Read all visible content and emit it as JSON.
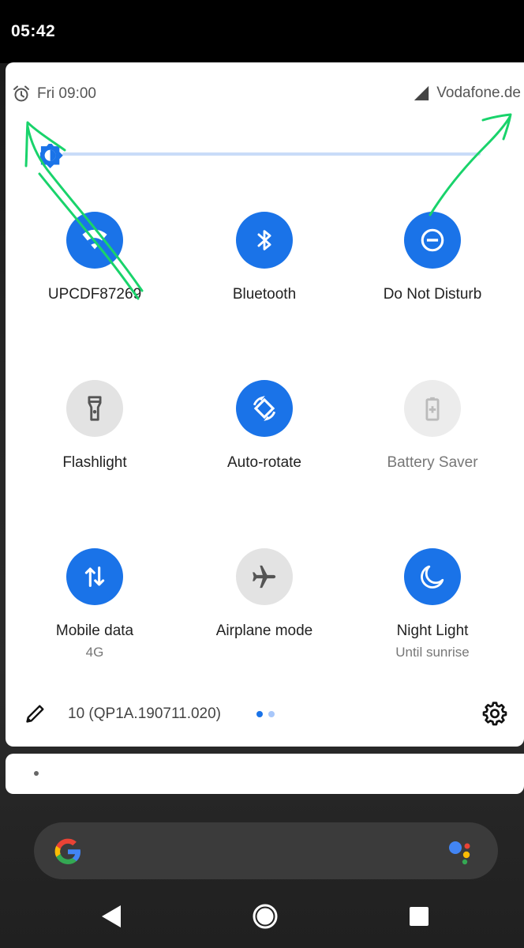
{
  "status_bar": {
    "time": "05:42"
  },
  "header": {
    "alarm": "Fri 09:00",
    "carrier": "Vodafone.de"
  },
  "brightness": {
    "level": 0.0
  },
  "tiles": [
    {
      "label": "UPCDF87269",
      "sub": "",
      "active": true,
      "icon": "wifi-icon"
    },
    {
      "label": "Bluetooth",
      "sub": "",
      "active": true,
      "icon": "bluetooth-icon"
    },
    {
      "label": "Do Not Disturb",
      "sub": "",
      "active": true,
      "icon": "do-not-disturb-icon"
    },
    {
      "label": "Flashlight",
      "sub": "",
      "active": false,
      "icon": "flashlight-icon"
    },
    {
      "label": "Auto-rotate",
      "sub": "",
      "active": true,
      "icon": "auto-rotate-icon"
    },
    {
      "label": "Battery Saver",
      "sub": "",
      "active": false,
      "unavailable": true,
      "icon": "battery-saver-icon"
    },
    {
      "label": "Mobile data",
      "sub": "4G",
      "active": true,
      "icon": "mobile-data-icon"
    },
    {
      "label": "Airplane mode",
      "sub": "",
      "active": false,
      "icon": "airplane-icon"
    },
    {
      "label": "Night Light",
      "sub": "Until sunrise",
      "active": true,
      "icon": "night-light-icon"
    }
  ],
  "footer": {
    "build": "10 (QP1A.190711.020)",
    "pages": 2,
    "current_page": 1
  },
  "colors": {
    "accent": "#1a73e8",
    "inactive_tile": "#e3e3e3",
    "annotation": "#19d36b",
    "page_dot_inactive": "#a8c7fa"
  }
}
